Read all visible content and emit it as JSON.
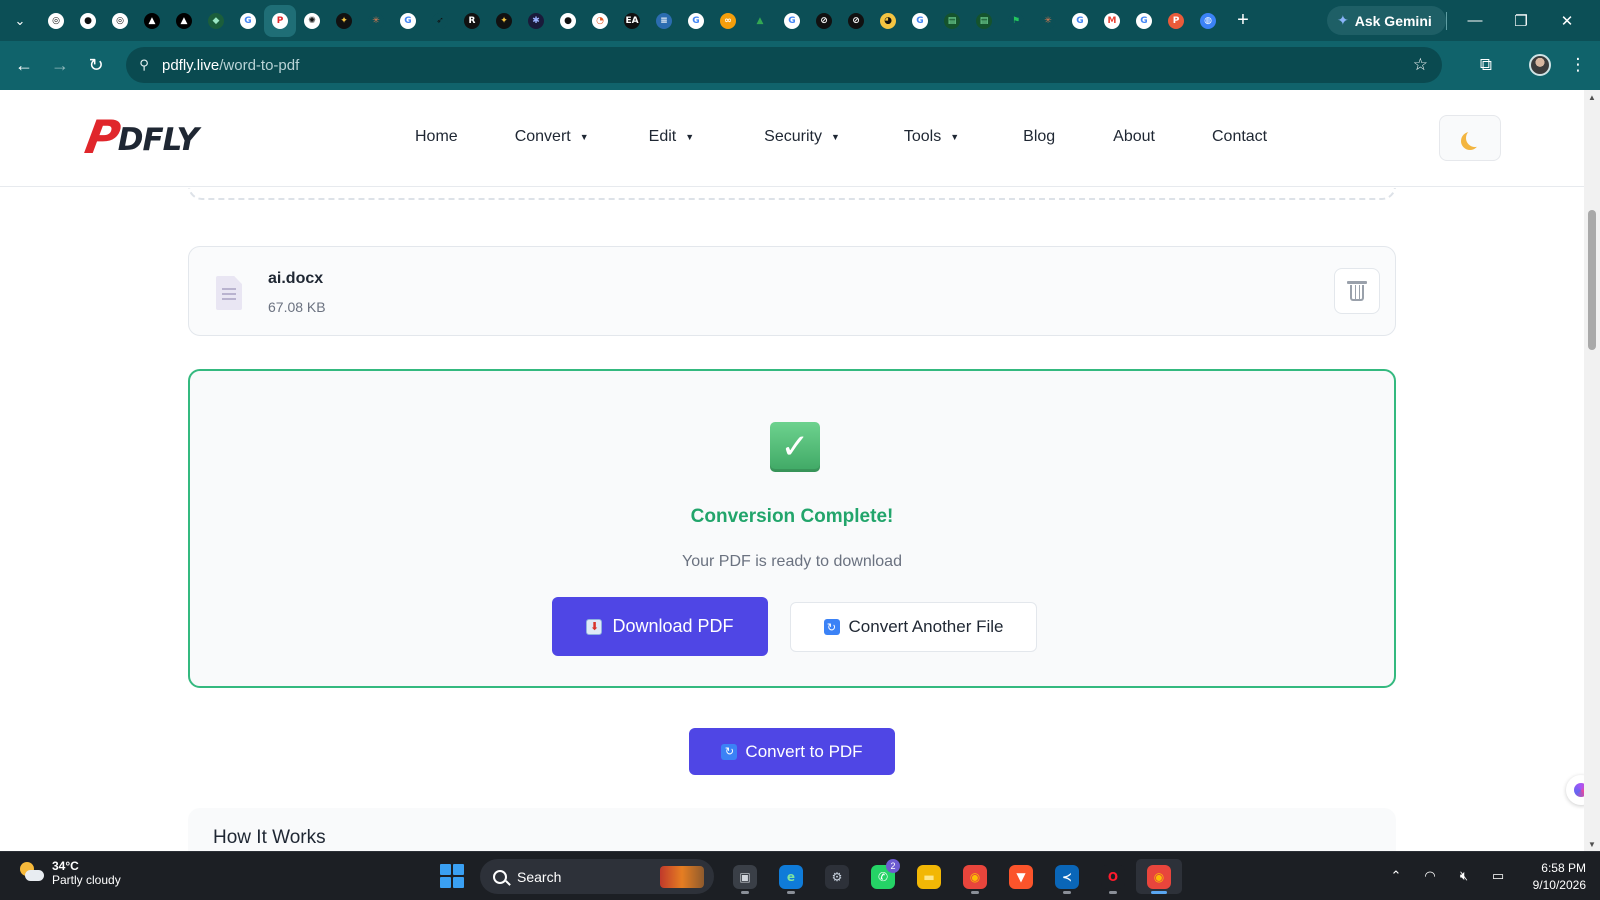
{
  "browser": {
    "tab_favicons": [
      {
        "icon": "chatgpt-icon",
        "bg": "#ffffff",
        "glyph": "◎",
        "fg": "#111111"
      },
      {
        "icon": "github-icon",
        "bg": "#ffffff",
        "glyph": "●",
        "fg": "#111111"
      },
      {
        "icon": "chatgpt-icon",
        "bg": "#ffffff",
        "glyph": "◎",
        "fg": "#111111"
      },
      {
        "icon": "vercel-icon",
        "bg": "#000000",
        "glyph": "▲",
        "fg": "#ffffff"
      },
      {
        "icon": "vercel-icon",
        "bg": "#000000",
        "glyph": "▲",
        "fg": "#ffffff"
      },
      {
        "icon": "shield-icon",
        "bg": "#1b5e3b",
        "glyph": "◆",
        "fg": "#9be7c4"
      },
      {
        "icon": "google-icon",
        "bg": "#ffffff",
        "glyph": "G",
        "fg": "#4285f4"
      },
      {
        "icon": "pdfly-icon",
        "bg": "#ffffff",
        "glyph": "P",
        "fg": "#e0262b"
      },
      {
        "icon": "openai-icon",
        "bg": "#ffffff",
        "glyph": "✺",
        "fg": "#111111"
      },
      {
        "icon": "sparkle-icon",
        "bg": "#111111",
        "glyph": "✦",
        "fg": "#f5c542"
      },
      {
        "icon": "claude-icon",
        "bg": "#0c4f56",
        "glyph": "✳",
        "fg": "#e07a4f"
      },
      {
        "icon": "google-icon",
        "bg": "#ffffff",
        "glyph": "G",
        "fg": "#4285f4"
      },
      {
        "icon": "bird-icon",
        "bg": "#0c4f56",
        "glyph": "➶",
        "fg": "#111111"
      },
      {
        "icon": "replit-icon",
        "bg": "#111111",
        "glyph": "R",
        "fg": "#ffffff"
      },
      {
        "icon": "sparkle-icon",
        "bg": "#111111",
        "glyph": "✦",
        "fg": "#f5c542"
      },
      {
        "icon": "app-icon",
        "bg": "#1a1a3a",
        "glyph": "✱",
        "fg": "#9bb3ff"
      },
      {
        "icon": "github-icon",
        "bg": "#ffffff",
        "glyph": "●",
        "fg": "#111111"
      },
      {
        "icon": "timer-icon",
        "bg": "#ffffff",
        "glyph": "◔",
        "fg": "#e25822"
      },
      {
        "icon": "ea-icon",
        "bg": "#111111",
        "glyph": "EA",
        "fg": "#ffffff"
      },
      {
        "icon": "stack-icon",
        "bg": "#2b6cb0",
        "glyph": "≡",
        "fg": "#ffffff"
      },
      {
        "icon": "google-icon",
        "bg": "#ffffff",
        "glyph": "G",
        "fg": "#4285f4"
      },
      {
        "icon": "infinity-icon",
        "bg": "#f59e0b",
        "glyph": "∞",
        "fg": "#ffffff"
      },
      {
        "icon": "drive-icon",
        "bg": "#0c4f56",
        "glyph": "▲",
        "fg": "#34a853"
      },
      {
        "icon": "google-icon",
        "bg": "#ffffff",
        "glyph": "G",
        "fg": "#4285f4"
      },
      {
        "icon": "perplexity-icon",
        "bg": "#111111",
        "glyph": "⊘",
        "fg": "#ffffff"
      },
      {
        "icon": "perplexity-icon",
        "bg": "#111111",
        "glyph": "⊘",
        "fg": "#ffffff"
      },
      {
        "icon": "pacman-icon",
        "bg": "#f5c542",
        "glyph": "◕",
        "fg": "#111111"
      },
      {
        "icon": "google-icon",
        "bg": "#ffffff",
        "glyph": "G",
        "fg": "#4285f4"
      },
      {
        "icon": "terminal-icon",
        "bg": "#14532d",
        "glyph": "▤",
        "fg": "#86efac"
      },
      {
        "icon": "terminal-icon",
        "bg": "#14532d",
        "glyph": "▤",
        "fg": "#86efac"
      },
      {
        "icon": "flag-icon",
        "bg": "#0c4f56",
        "glyph": "⚑",
        "fg": "#22c55e"
      },
      {
        "icon": "claude-icon",
        "bg": "#0c4f56",
        "glyph": "✳",
        "fg": "#e07a4f"
      },
      {
        "icon": "google-icon",
        "bg": "#ffffff",
        "glyph": "G",
        "fg": "#4285f4"
      },
      {
        "icon": "gmail-icon",
        "bg": "#ffffff",
        "glyph": "M",
        "fg": "#ea4335"
      },
      {
        "icon": "google-icon",
        "bg": "#ffffff",
        "glyph": "G",
        "fg": "#4285f4"
      },
      {
        "icon": "producthunt-icon",
        "bg": "#ea5b3a",
        "glyph": "P",
        "fg": "#ffffff"
      },
      {
        "icon": "globe-icon",
        "bg": "#3b82f6",
        "glyph": "◍",
        "fg": "#ffffff"
      }
    ],
    "active_tab_index": 7,
    "ask_gemini": "Ask Gemini",
    "url_domain": "pdfly.live",
    "url_path": "/word-to-pdf"
  },
  "site": {
    "logo_mark": "P",
    "logo_text": "DFLY",
    "nav": [
      {
        "label": "Home",
        "dropdown": false
      },
      {
        "label": "Convert",
        "dropdown": true
      },
      {
        "label": "Edit",
        "dropdown": true
      },
      {
        "label": "Security",
        "dropdown": true
      },
      {
        "label": "Tools",
        "dropdown": true
      },
      {
        "label": "Blog",
        "dropdown": false
      },
      {
        "label": "About",
        "dropdown": false
      },
      {
        "label": "Contact",
        "dropdown": false
      }
    ],
    "accent": "#4f46e5",
    "success_color": "#22a56b"
  },
  "file": {
    "name": "ai.docx",
    "size": "67.08 KB"
  },
  "result": {
    "title": "Conversion Complete!",
    "subtitle": "Your PDF is ready to download",
    "download_label": "Download PDF",
    "again_label": "Convert Another File"
  },
  "convert_button": "Convert to PDF",
  "how_it_works": "How It Works",
  "taskbar": {
    "temperature": "34°C",
    "condition": "Partly cloudy",
    "search_placeholder": "Search",
    "whatsapp_badge": "2",
    "time": "6:58 PM",
    "date": "9/10/2026",
    "apps": [
      {
        "name": "file-manager-icon",
        "bg": "#3a3f47",
        "glyph": "▣",
        "fg": "#d1d5db"
      },
      {
        "name": "edge-icon",
        "bg": "#0f7bd8",
        "glyph": "e",
        "fg": "#7ee3a1"
      },
      {
        "name": "settings-icon",
        "bg": "#2d3139",
        "glyph": "⚙",
        "fg": "#cbd5e1"
      },
      {
        "name": "whatsapp-icon",
        "bg": "#25d366",
        "glyph": "✆",
        "fg": "#ffffff"
      },
      {
        "name": "folder-icon",
        "bg": "#f2b705",
        "glyph": "▬",
        "fg": "#fde68a"
      },
      {
        "name": "chrome-icon",
        "bg": "#e8453c",
        "glyph": "◉",
        "fg": "#fbbc05"
      },
      {
        "name": "brave-icon",
        "bg": "#fb542b",
        "glyph": "▼",
        "fg": "#ffffff"
      },
      {
        "name": "vscode-icon",
        "bg": "#0a66b8",
        "glyph": "≺",
        "fg": "#ffffff"
      },
      {
        "name": "opera-icon",
        "bg": "#1c1f24",
        "glyph": "O",
        "fg": "#ff1b2d"
      },
      {
        "name": "chrome-icon",
        "bg": "#e8453c",
        "glyph": "◉",
        "fg": "#fbbc05"
      }
    ]
  }
}
